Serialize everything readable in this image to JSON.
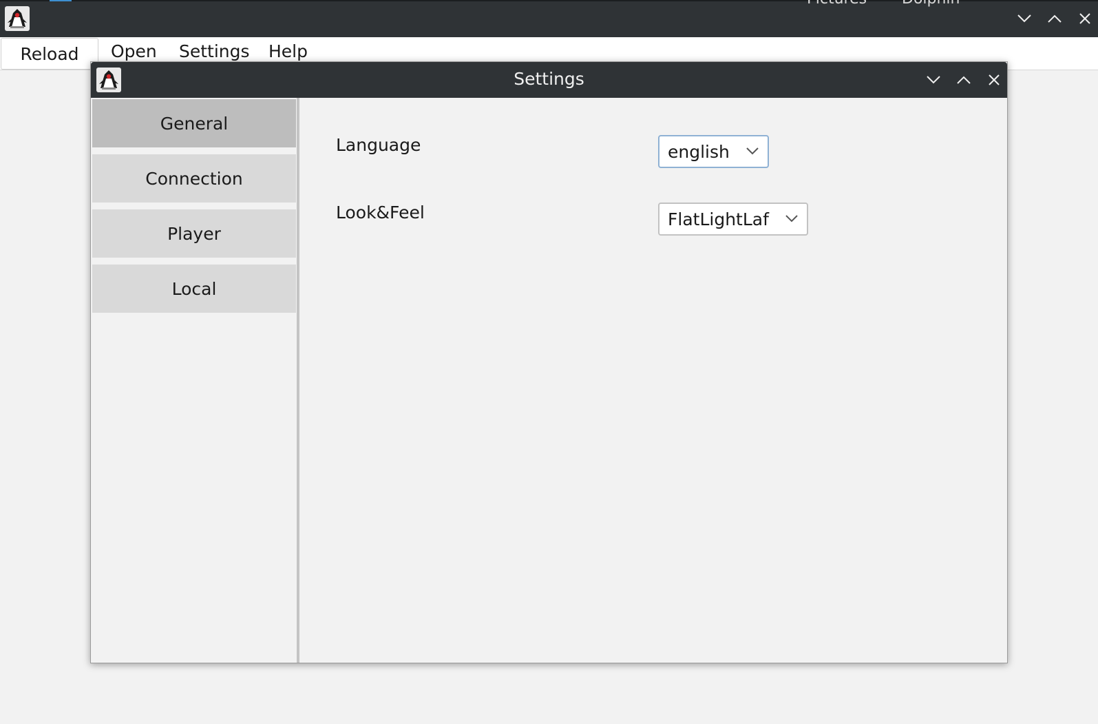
{
  "main_window": {
    "peek_text_left": "Pictures",
    "peek_text_right": "Dolphin",
    "icon": "java-duke-icon"
  },
  "menubar": {
    "reload_label": "Reload",
    "items": [
      {
        "label": "Open"
      },
      {
        "label": "Settings"
      },
      {
        "label": "Help"
      }
    ]
  },
  "dialog": {
    "title": "Settings",
    "icon": "java-duke-icon",
    "sidebar": [
      {
        "label": "General",
        "selected": true
      },
      {
        "label": "Connection",
        "selected": false
      },
      {
        "label": "Player",
        "selected": false
      },
      {
        "label": "Local",
        "selected": false
      }
    ],
    "fields": {
      "language": {
        "label": "Language",
        "value": "english"
      },
      "look_and_feel": {
        "label": "Look&Feel",
        "value": "FlatLightLaf"
      }
    }
  },
  "colors": {
    "titlebar": "#2f3336",
    "selected_tab": "#bdbdbd",
    "tab": "#d9d9d9",
    "focus_border": "#8fb1d4",
    "background": "#f2f2f2"
  }
}
